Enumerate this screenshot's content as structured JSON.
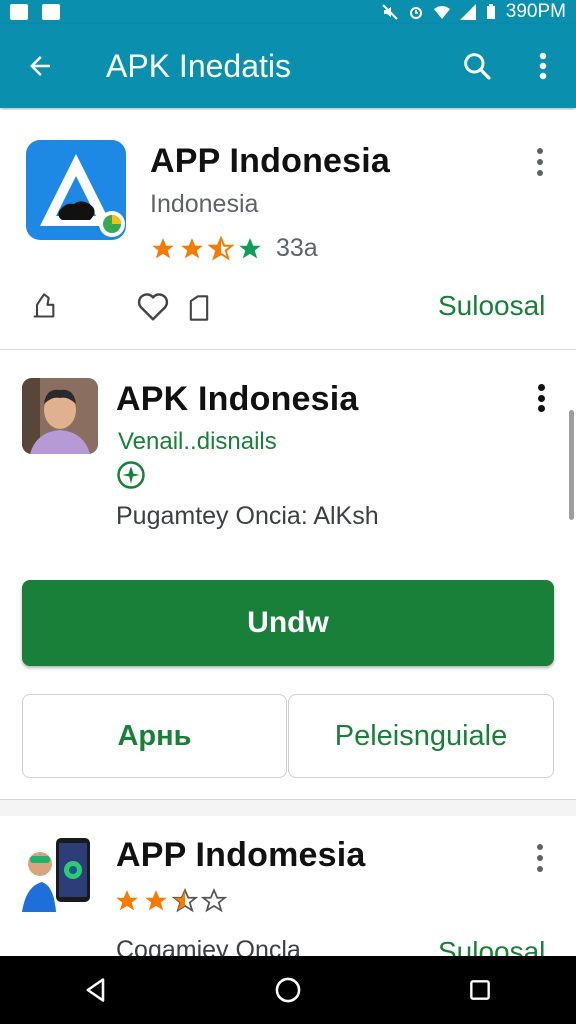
{
  "status_bar": {
    "time": "390PM"
  },
  "app_bar": {
    "title": "APK Inedatis"
  },
  "card1": {
    "name": "APP Indonesia",
    "subtitle": "Indonesia",
    "rating_stars": 3.5,
    "rating_text": "33a",
    "action_label": "Suloosal"
  },
  "card2": {
    "name": "APK Indonesia",
    "developer": "Venail..disnails",
    "info": "Pugamtey Oncia: AlKsh",
    "primary_button": "Undw",
    "secondary_button_left": "Apнь",
    "secondary_button_right": "Peleisnguiale"
  },
  "card3": {
    "name": "APP Indomesia",
    "rating_stars": 2.5,
    "subtitle": "Cogamiey Oncla",
    "action_label": "Suloosal"
  },
  "colors": {
    "app_bar": "#0b8fae",
    "primary_green": "#188038",
    "star_orange": "#f57c00",
    "star_green": "#0f9d58"
  }
}
